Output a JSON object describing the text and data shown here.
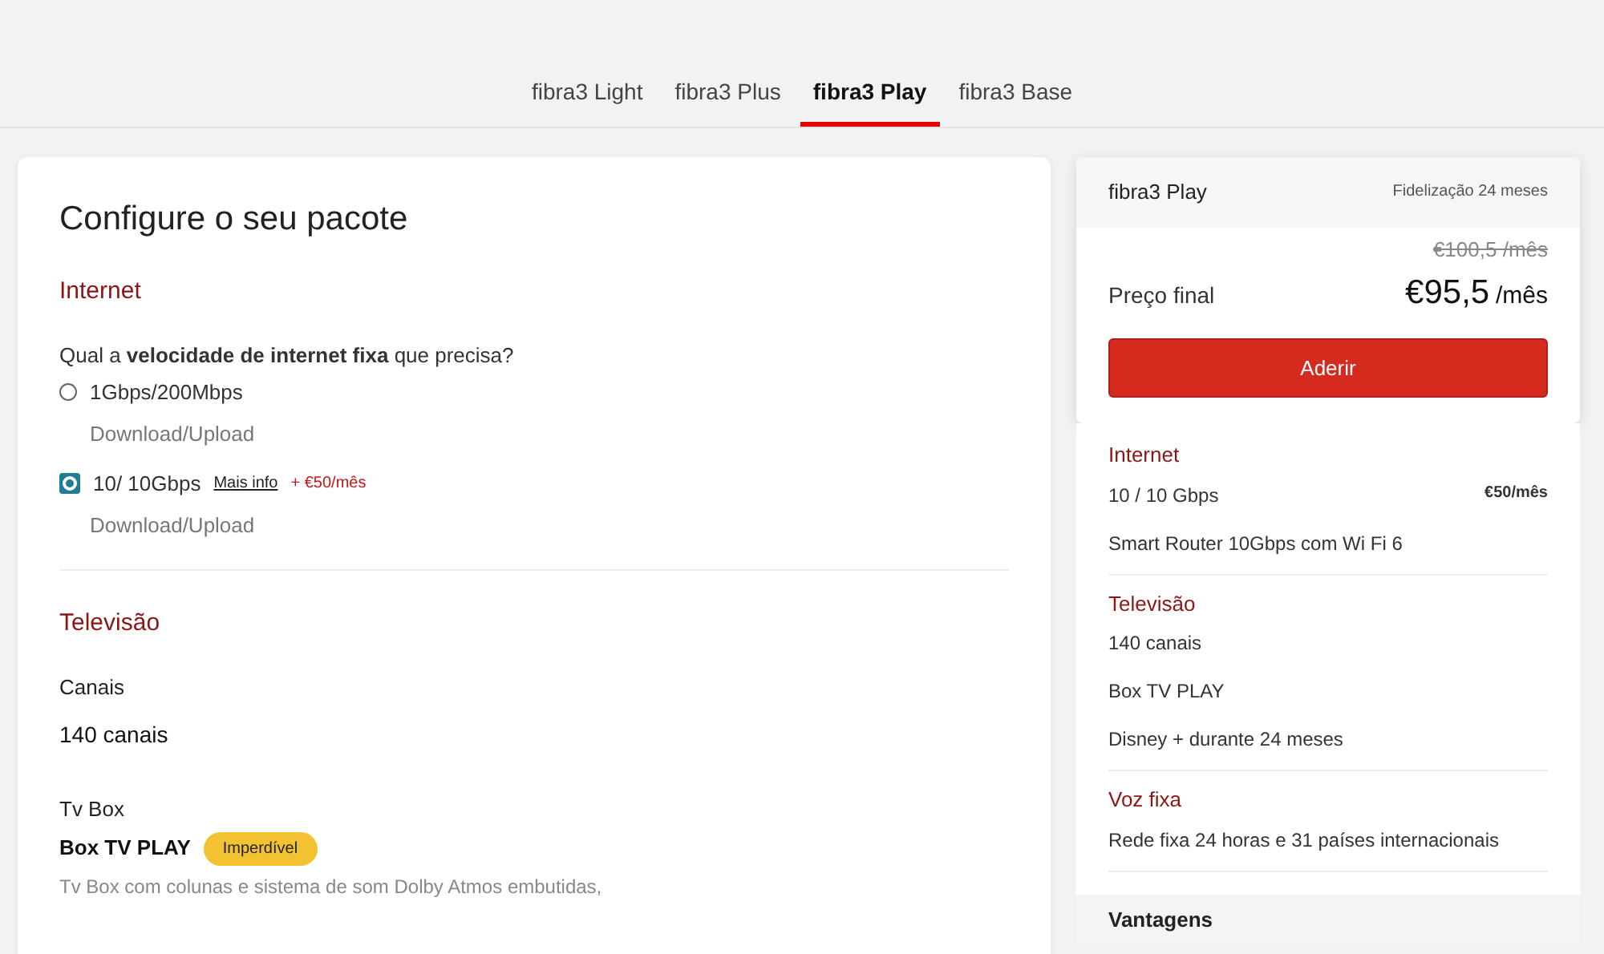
{
  "tabs": [
    {
      "label": "fibra3 Light",
      "selected": false
    },
    {
      "label": "fibra3 Plus",
      "selected": false
    },
    {
      "label": "fibra3 Play",
      "selected": true
    },
    {
      "label": "fibra3 Base",
      "selected": false
    }
  ],
  "configurator": {
    "title": "Configure o seu pacote",
    "internet": {
      "heading": "Internet",
      "question": "Qual a **velocidade de internet fixa** que precisa?",
      "options": [
        {
          "label": "1Gbps/200Mbps",
          "sub": "Download/Upload",
          "selected": false
        },
        {
          "label": "10/ 10Gbps",
          "link": "Mais info",
          "extra": "+ €50/mês",
          "sub": "Download/Upload",
          "selected": true
        }
      ]
    },
    "television": {
      "heading": "Televisão",
      "channels_label": "Canais",
      "channels_value": "140 canais",
      "box_label": "Tv Box",
      "box_name": "Box TV PLAY",
      "badge": "Imperdível",
      "description": "Tv Box com colunas e sistema de som Dolby Atmos embutidas,"
    }
  },
  "summary": {
    "plan": "fibra3 Play",
    "commitment": "Fidelização 24 meses",
    "old_price": "€100,5 /mês",
    "price_label": "Preço final",
    "price": "€95,5",
    "price_unit": "/mês",
    "button": "Aderir",
    "groups": [
      {
        "heading": "Internet",
        "lines": [
          {
            "text": "10 / 10 Gbps",
            "price": "€50/mês"
          },
          {
            "text": "Smart Router 10Gbps com Wi Fi 6"
          }
        ]
      },
      {
        "heading": "Televisão",
        "lines": [
          {
            "text": "140 canais"
          },
          {
            "text": "Box TV PLAY"
          },
          {
            "text": "Disney + durante 24 meses"
          }
        ]
      },
      {
        "heading": "Voz fixa",
        "lines": [
          {
            "text": "Rede fixa 24 horas e 31 países internacionais"
          }
        ]
      }
    ],
    "footer": "Vantagens"
  }
}
